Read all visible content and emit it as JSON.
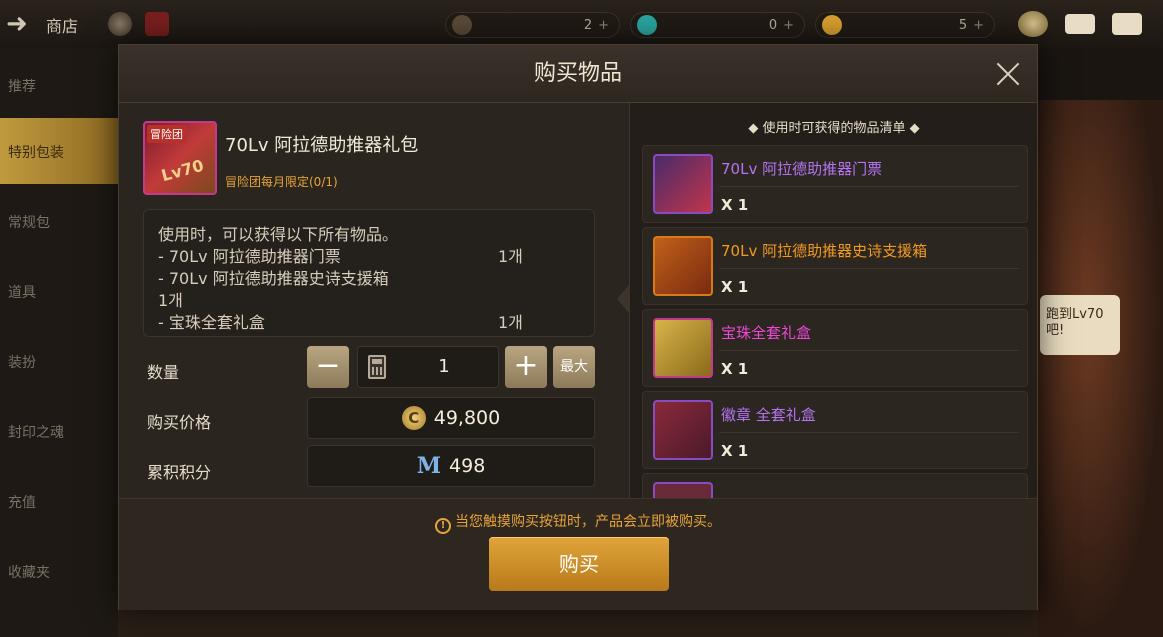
{
  "topbar": {
    "shop_title": "商店",
    "currencies": [
      {
        "value": "2",
        "plus": "+"
      },
      {
        "value": "0",
        "plus": "+"
      },
      {
        "value": "5",
        "plus": "+"
      }
    ]
  },
  "sidebar": {
    "items": [
      {
        "label": "推荐"
      },
      {
        "label": "特别包装"
      },
      {
        "label": "常规包"
      },
      {
        "label": "道具"
      },
      {
        "label": "装扮"
      },
      {
        "label": "封印之魂"
      },
      {
        "label": "充值"
      },
      {
        "label": "收藏夹"
      }
    ]
  },
  "background": {
    "badge_text": "跑到Lv70吧!"
  },
  "modal": {
    "title": "购买物品",
    "item": {
      "icon_tag": "冒险团",
      "icon_lv": "Lv70",
      "name": "70Lv 阿拉德助推器礼包",
      "limit": "冒险团每月限定(0/1)"
    },
    "description": {
      "intro": "使用时，可以获得以下所有物品。",
      "lines": [
        {
          "text": " - 70Lv 阿拉德助推器门票",
          "count": "1개"
        },
        {
          "text": " - 70Lv 阿拉德助推器史诗支援箱",
          "count": ""
        },
        {
          "text": "1개",
          "count": ""
        },
        {
          "text": " - 宝珠全套礼盒",
          "count": "1개"
        }
      ]
    },
    "quantity": {
      "label": "数量",
      "minus": "−",
      "value": "1",
      "plus": "+",
      "max": "最大"
    },
    "price": {
      "label": "购买价格",
      "coin_symbol": "C",
      "value": "49,800"
    },
    "points": {
      "label": "累积积分",
      "symbol": "M",
      "value": "498"
    },
    "reward_list": {
      "header": "◆  使用时可获得的物品清单  ◆",
      "items": [
        {
          "name": "70Lv 阿拉德助推器门票",
          "qty": "X 1",
          "color": "#b574f2"
        },
        {
          "name": "70Lv 阿拉德助推器史诗支援箱",
          "qty": "X 1",
          "color": "#f39a1f"
        },
        {
          "name": "宝珠全套礼盒",
          "qty": "X 1",
          "color": "#ee48d8"
        },
        {
          "name": "徽章 全套礼盒",
          "qty": "X 1",
          "color": "#b574f2"
        }
      ]
    },
    "notice": "当您触摸购买按钮时，产品会立即被购买。",
    "buy_label": "购买"
  }
}
